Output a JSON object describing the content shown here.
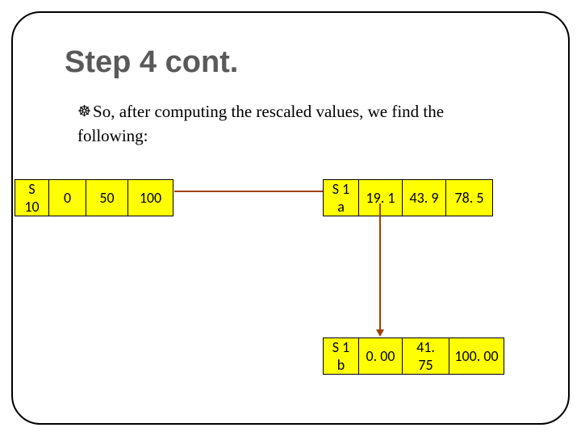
{
  "title": "Step 4 cont.",
  "bullet_glyph": "༄",
  "body_line1": "So, after computing the rescaled values, we find the",
  "body_line2": "following:",
  "tables": {
    "s10": {
      "label": "S 10",
      "v1": "0",
      "v2": "50",
      "v3": "100"
    },
    "s1a": {
      "label": "S 1 a",
      "v1": "19. 1",
      "v2": "43. 9",
      "v3": "78. 5"
    },
    "s1b": {
      "label": "S 1 b",
      "v1": "0. 00",
      "v2": "41. 75",
      "v3": "100. 00"
    }
  },
  "chart_data": {
    "type": "table",
    "title": "Rescaled values (Step 4)",
    "series": [
      {
        "name": "S10",
        "values": [
          0,
          50,
          100
        ]
      },
      {
        "name": "S1a",
        "values": [
          19.1,
          43.9,
          78.5
        ]
      },
      {
        "name": "S1b",
        "values": [
          0.0,
          41.75,
          100.0
        ]
      }
    ]
  }
}
